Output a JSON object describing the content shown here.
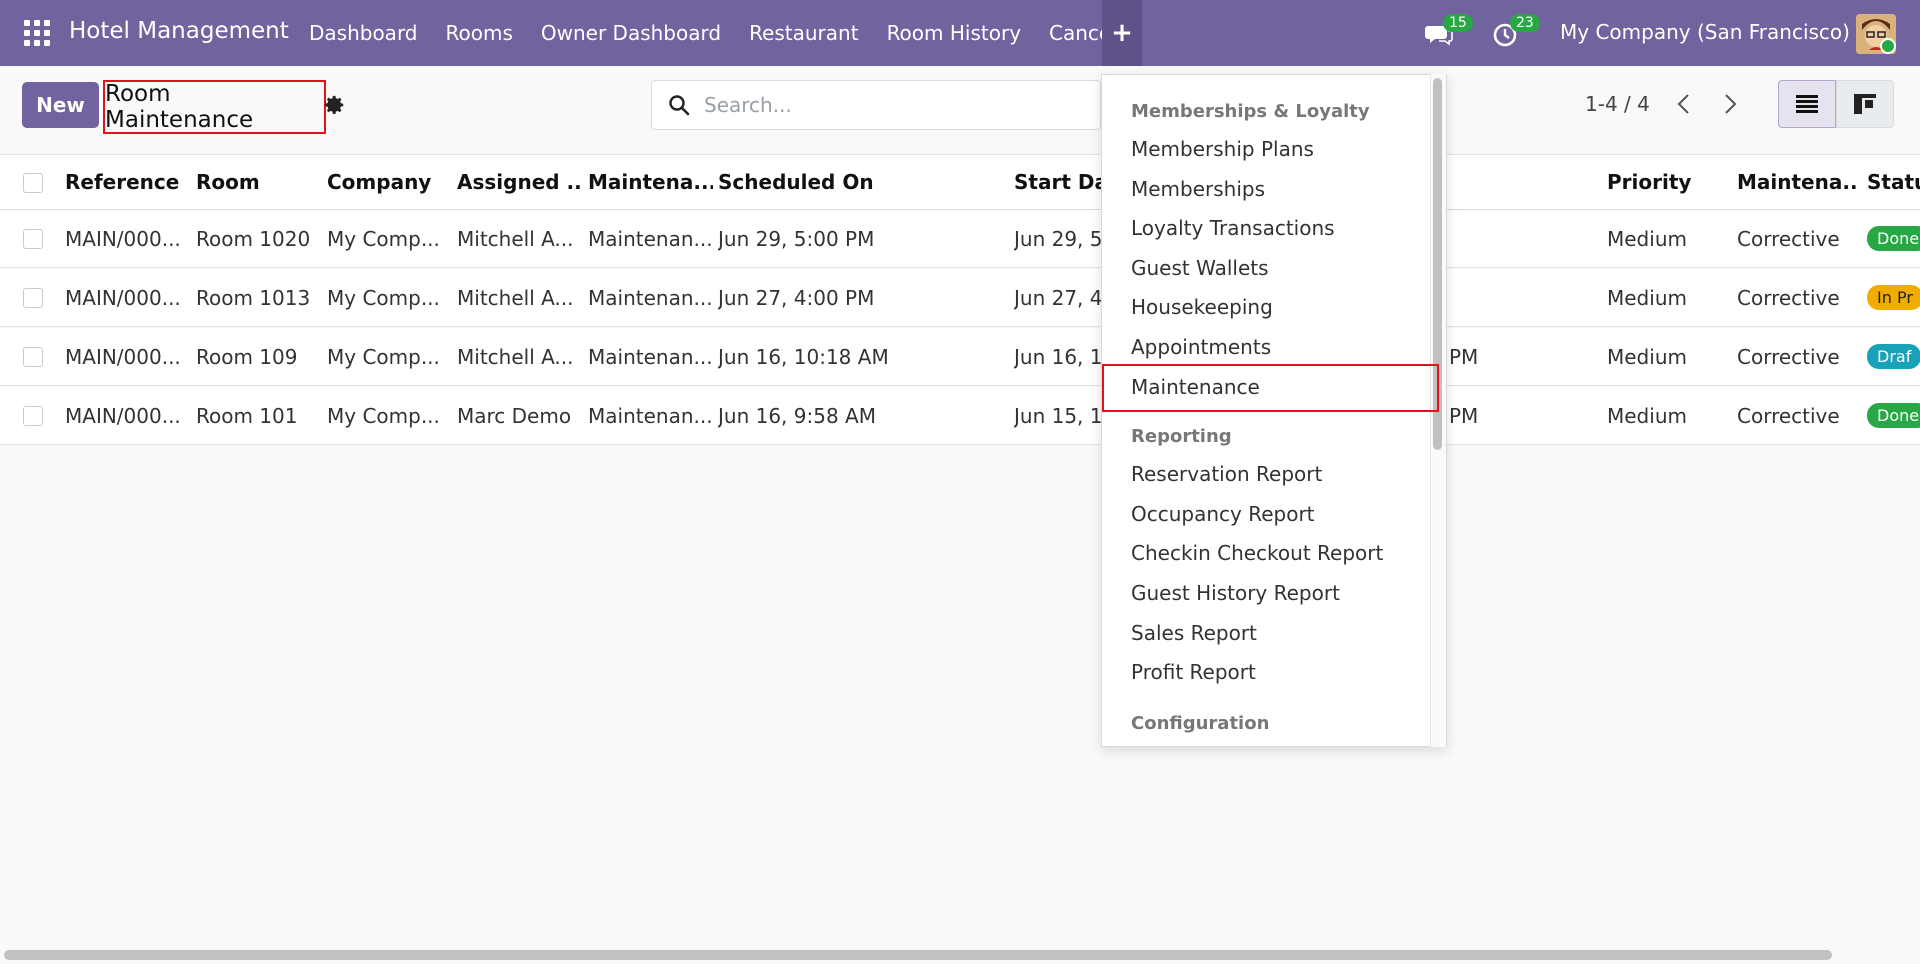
{
  "navbar": {
    "brand": "Hotel Management",
    "menu": [
      "Dashboard",
      "Rooms",
      "Owner Dashboard",
      "Restaurant",
      "Room History",
      "Cancel"
    ],
    "plus_label": "+",
    "chat_count": "15",
    "activity_count": "23",
    "company": "My Company (San Francisco)"
  },
  "control": {
    "new_label": "New",
    "title": "Room Maintenance",
    "search_placeholder": "Search...",
    "pager": "1-4 / 4"
  },
  "table": {
    "headers": [
      "Reference",
      "Room",
      "Company",
      "Assigned ...",
      "Maintena...",
      "Scheduled On",
      "Start Dat",
      "Priority",
      "Maintena...",
      "Statu"
    ],
    "rows": [
      {
        "reference": "MAIN/000...",
        "room": "Room 1020",
        "company": "My Comp...",
        "assigned": "Mitchell A...",
        "maint": "Maintenan...",
        "scheduled": "Jun 29, 5:00 PM",
        "start": "Jun 29, 5",
        "end": "",
        "priority": "Medium",
        "type": "Corrective",
        "status": "Done"
      },
      {
        "reference": "MAIN/000...",
        "room": "Room 1013",
        "company": "My Comp...",
        "assigned": "Mitchell A...",
        "maint": "Maintenan...",
        "scheduled": "Jun 27, 4:00 PM",
        "start": "Jun 27, 4",
        "end": "",
        "priority": "Medium",
        "type": "Corrective",
        "status": "In Pr"
      },
      {
        "reference": "MAIN/000...",
        "room": "Room 109",
        "company": "My Comp...",
        "assigned": "Mitchell A...",
        "maint": "Maintenan...",
        "scheduled": "Jun 16, 10:18 AM",
        "start": "Jun 16, 1",
        "end": "PM",
        "priority": "Medium",
        "type": "Corrective",
        "status": "Draf"
      },
      {
        "reference": "MAIN/000...",
        "room": "Room 101",
        "company": "My Comp...",
        "assigned": "Marc Demo",
        "maint": "Maintenan...",
        "scheduled": "Jun 16, 9:58 AM",
        "start": "Jun 15, 1",
        "end": "PM",
        "priority": "Medium",
        "type": "Corrective",
        "status": "Done"
      }
    ],
    "status_colors": {
      "done": "#28a745",
      "in_progress": "#f0ad00",
      "draft": "#17a2b8"
    }
  },
  "dropdown": {
    "section1": "Memberships & Loyalty",
    "items1": [
      "Membership Plans",
      "Memberships",
      "Loyalty Transactions",
      "Guest Wallets",
      "Housekeeping",
      "Appointments",
      "Maintenance"
    ],
    "section2": "Reporting",
    "items2": [
      "Reservation Report",
      "Occupancy Report",
      "Checkin Checkout Report",
      "Guest History Report",
      "Sales Report",
      "Profit Report"
    ],
    "section3": "Configuration"
  },
  "colors": {
    "brand": "#71639e",
    "highlight": "#e3121b"
  }
}
